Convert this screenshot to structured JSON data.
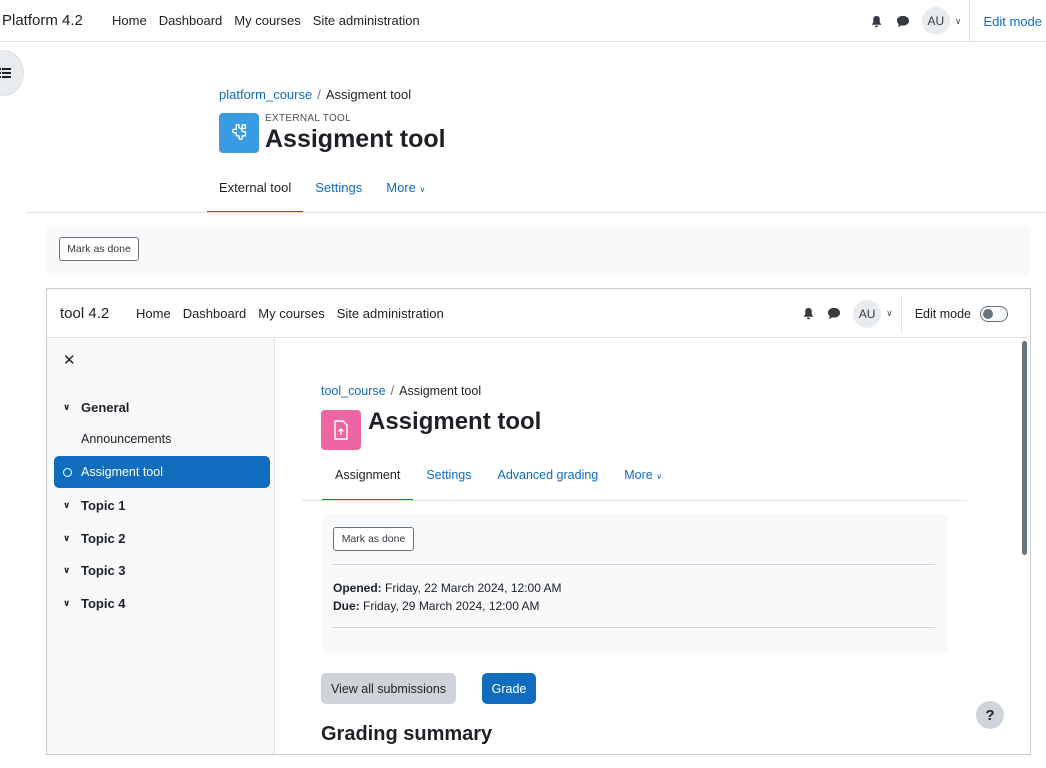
{
  "outer": {
    "brand": "Platform 4.2",
    "nav": [
      "Home",
      "Dashboard",
      "My courses",
      "Site administration"
    ],
    "avatar": "AU",
    "edit_mode": "Edit mode",
    "breadcrumb": {
      "course": "platform_course",
      "current": "Assigment tool"
    },
    "activity_label": "EXTERNAL TOOL",
    "title": "Assigment tool",
    "tabs": [
      {
        "label": "External tool",
        "active": true
      },
      {
        "label": "Settings",
        "active": false
      },
      {
        "label": "More",
        "active": false
      }
    ],
    "mark_done": "Mark as done"
  },
  "inner": {
    "brand": "tool 4.2",
    "nav": [
      "Home",
      "Dashboard",
      "My courses",
      "Site administration"
    ],
    "avatar": "AU",
    "edit_mode": "Edit mode",
    "sidebar": {
      "sections": [
        "General",
        "Topic 1",
        "Topic 2",
        "Topic 3",
        "Topic 4"
      ],
      "general_items": [
        "Announcements",
        "Assigment tool"
      ]
    },
    "breadcrumb": {
      "course": "tool_course",
      "current": "Assigment tool"
    },
    "title": "Assigment tool",
    "tabs": [
      {
        "label": "Assignment",
        "active": true
      },
      {
        "label": "Settings",
        "active": false
      },
      {
        "label": "Advanced grading",
        "active": false
      },
      {
        "label": "More",
        "active": false
      }
    ],
    "mark_done": "Mark as done",
    "opened_label": "Opened:",
    "opened_value": "Friday, 22 March 2024, 12:00 AM",
    "due_label": "Due:",
    "due_value": "Friday, 29 March 2024, 12:00 AM",
    "view_all": "View all submissions",
    "grade": "Grade",
    "grading_summary": "Grading summary",
    "help": "?"
  }
}
